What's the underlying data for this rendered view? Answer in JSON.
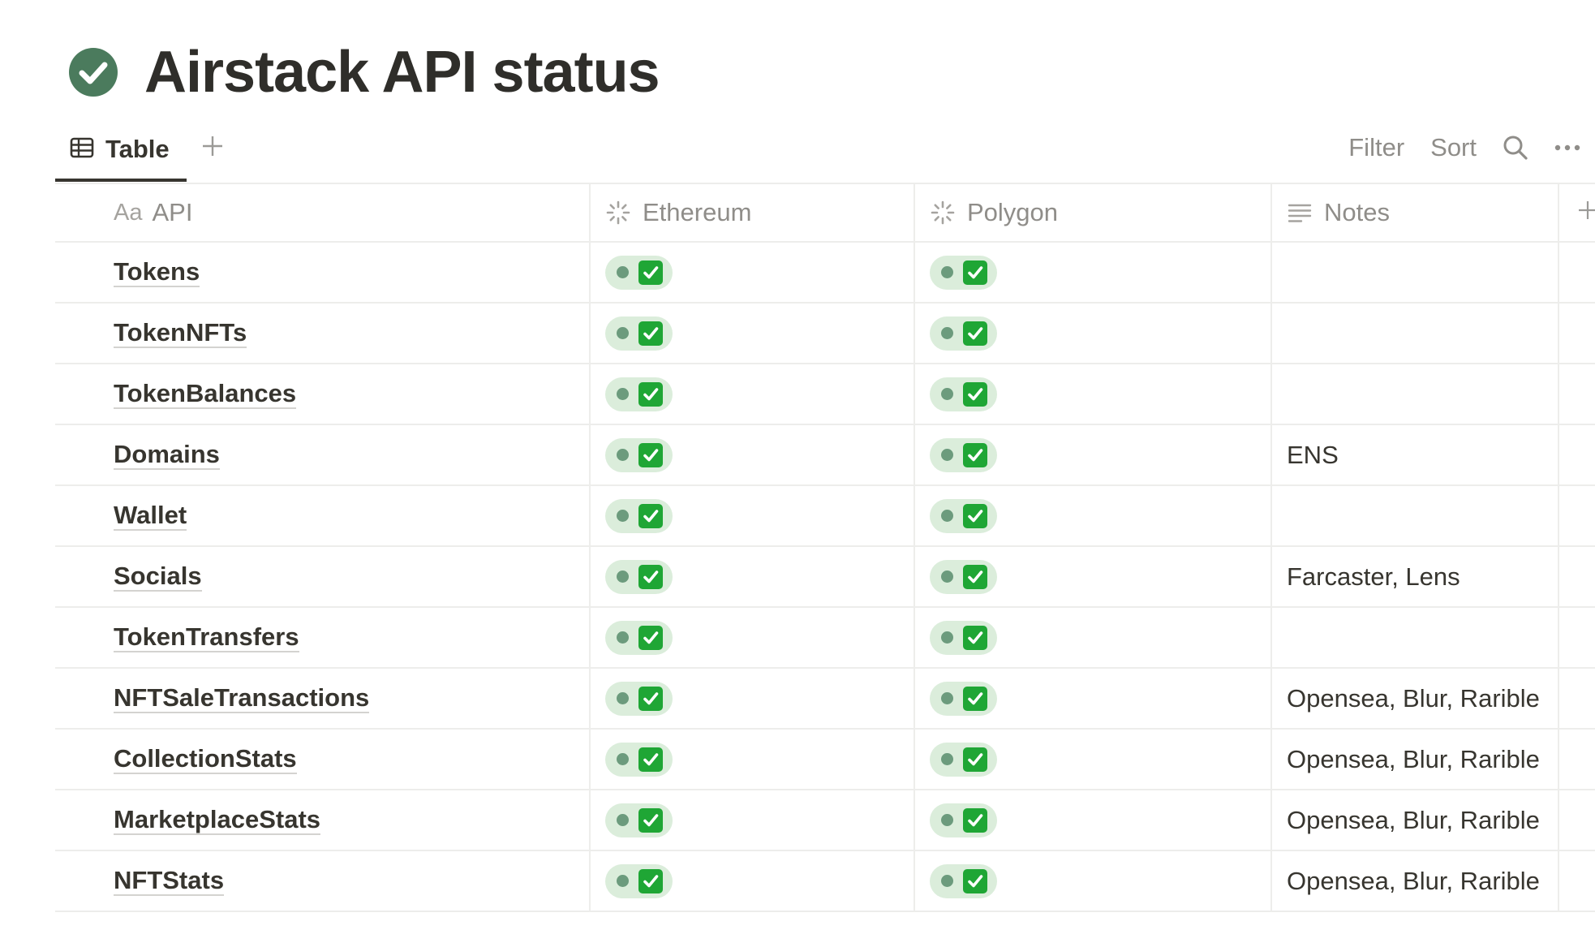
{
  "page": {
    "title": "Airstack API status",
    "icon": "check-circle-icon",
    "icon_color": "#4b7b5d"
  },
  "toolbar": {
    "view_label": "Table",
    "view_icon": "table-icon",
    "add_view_icon": "plus-icon",
    "filter_label": "Filter",
    "sort_label": "Sort",
    "search_icon": "search-icon",
    "more_icon": "more-icon"
  },
  "table": {
    "columns": [
      {
        "label": "API",
        "prefix": "Aa",
        "icon": "title-property-icon"
      },
      {
        "label": "Ethereum",
        "icon": "status-property-icon"
      },
      {
        "label": "Polygon",
        "icon": "status-property-icon"
      },
      {
        "label": "Notes",
        "icon": "text-property-icon"
      }
    ],
    "add_column_icon": "plus-icon",
    "status_value": "✅",
    "status_pill_color": "#dbeddb",
    "status_dot_color": "#6c9b7d",
    "rows": [
      {
        "api": "Tokens",
        "ethereum": "✅",
        "polygon": "✅",
        "notes": ""
      },
      {
        "api": "TokenNFTs",
        "ethereum": "✅",
        "polygon": "✅",
        "notes": ""
      },
      {
        "api": "TokenBalances",
        "ethereum": "✅",
        "polygon": "✅",
        "notes": ""
      },
      {
        "api": "Domains",
        "ethereum": "✅",
        "polygon": "✅",
        "notes": "ENS"
      },
      {
        "api": "Wallet",
        "ethereum": "✅",
        "polygon": "✅",
        "notes": ""
      },
      {
        "api": "Socials",
        "ethereum": "✅",
        "polygon": "✅",
        "notes": "Farcaster, Lens"
      },
      {
        "api": "TokenTransfers",
        "ethereum": "✅",
        "polygon": "✅",
        "notes": ""
      },
      {
        "api": "NFTSaleTransactions",
        "ethereum": "✅",
        "polygon": "✅",
        "notes": "Opensea, Blur, Rarible"
      },
      {
        "api": "CollectionStats",
        "ethereum": "✅",
        "polygon": "✅",
        "notes": "Opensea, Blur, Rarible"
      },
      {
        "api": "MarketplaceStats",
        "ethereum": "✅",
        "polygon": "✅",
        "notes": "Opensea, Blur, Rarible"
      },
      {
        "api": "NFTStats",
        "ethereum": "✅",
        "polygon": "✅",
        "notes": "Opensea, Blur, Rarible"
      }
    ]
  }
}
